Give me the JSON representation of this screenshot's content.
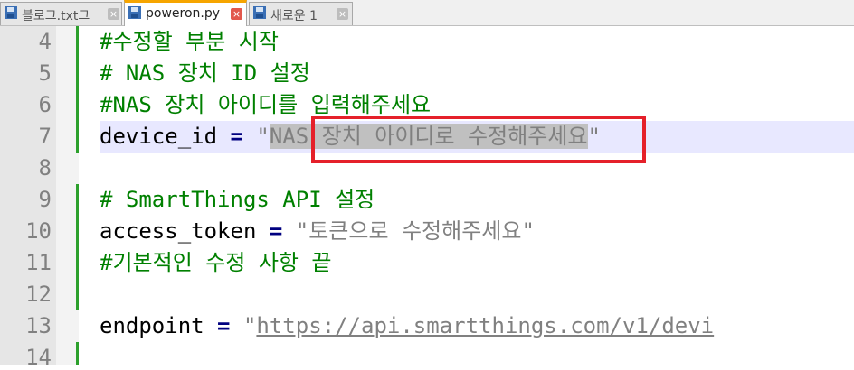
{
  "tabs": [
    {
      "label": "블로그.txt그",
      "active": false,
      "icon": "save-disk-icon"
    },
    {
      "label": "poweron.py",
      "active": true,
      "icon": "save-disk-icon"
    },
    {
      "label": "새로운 1",
      "active": false,
      "icon": "save-disk-icon"
    }
  ],
  "close_symbol": "×",
  "line_numbers": [
    "4",
    "5",
    "6",
    "7",
    "8",
    "9",
    "10",
    "11",
    "12",
    "13",
    "14"
  ],
  "code": {
    "l4": "#수정할 부분 시작",
    "l5": "# NAS 장치 ID 설정",
    "l6": "#NAS 장치 아이디를 입력해주세요",
    "l7_var": "device_id",
    "l7_op": " = ",
    "l7_q1": "\"",
    "l7_sel": "NAS 장치 아이디로 수정해주세요",
    "l7_q2": "\"",
    "l9": "# SmartThings API 설정",
    "l10_var": "access_token",
    "l10_op": " = ",
    "l10_str": "\"토큰으로 수정해주세요\"",
    "l11": "#기본적인 수정 사항 끝",
    "l13_var": "endpoint",
    "l13_op": " = ",
    "l13_q": "\"",
    "l13_url": "https://api.smartthings.com/v1/devi"
  },
  "colors": {
    "comment": "#008000",
    "operator": "#000080",
    "string": "#808080",
    "current_line": "#e8e8ff",
    "selection": "#c0c0c0",
    "annotation_box": "#e5202a",
    "active_tab_accent": "#f6a500"
  }
}
